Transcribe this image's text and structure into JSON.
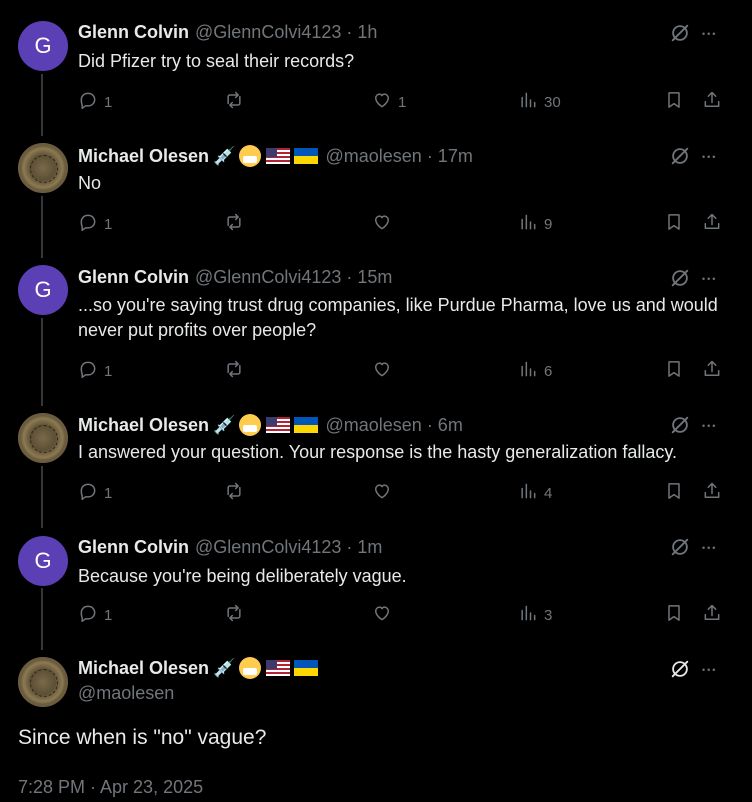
{
  "replies": [
    {
      "name": "Glenn Colvin",
      "handle": "@GlennColvi4123",
      "time": "· 1h",
      "avatar_letter": "G",
      "text": "Did Pfizer try to seal their records?",
      "counts": {
        "replies": "1",
        "retweets": "",
        "likes": "1",
        "views": "30"
      },
      "liked": false
    },
    {
      "name": "Michael Olesen",
      "handle": "@maolesen",
      "time": "· 17m",
      "avatar_letter": "",
      "text": "No",
      "counts": {
        "replies": "1",
        "retweets": "",
        "likes": "",
        "views": "9"
      }
    },
    {
      "name": "Glenn Colvin",
      "handle": "@GlennColvi4123",
      "time": "· 15m",
      "avatar_letter": "G",
      "text": "...so you're saying trust drug companies, like Purdue Pharma, love us and would never put profits over people?",
      "counts": {
        "replies": "1",
        "retweets": "",
        "likes": "",
        "views": "6"
      }
    },
    {
      "name": "Michael Olesen",
      "handle": "@maolesen",
      "time": "· 6m",
      "avatar_letter": "",
      "text": "I answered your question. Your response is the hasty generalization fallacy.",
      "counts": {
        "replies": "1",
        "retweets": "",
        "likes": "",
        "views": "4"
      }
    },
    {
      "name": "Glenn Colvin",
      "handle": "@GlennColvi4123",
      "time": "· 1m",
      "avatar_letter": "G",
      "text": "Because you're being deliberately vague.",
      "counts": {
        "replies": "1",
        "retweets": "",
        "likes": "",
        "views": "3"
      }
    }
  ],
  "main": {
    "name": "Michael Olesen",
    "handle": "@maolesen",
    "text": "Since when is \"no\" vague?",
    "timestamp": "7:28 PM · Apr 23, 2025"
  },
  "icons": {
    "reply": "reply-icon",
    "retweet": "retweet-icon",
    "like": "heart-icon",
    "views": "views-icon",
    "bookmark": "bookmark-icon",
    "share": "share-icon",
    "grok": "grok-icon",
    "more": "more-icon"
  },
  "colors": {
    "background": "#000000",
    "text": "#e7e9ea",
    "muted": "#71767b",
    "glenn_avatar": "#5b3fb5"
  }
}
